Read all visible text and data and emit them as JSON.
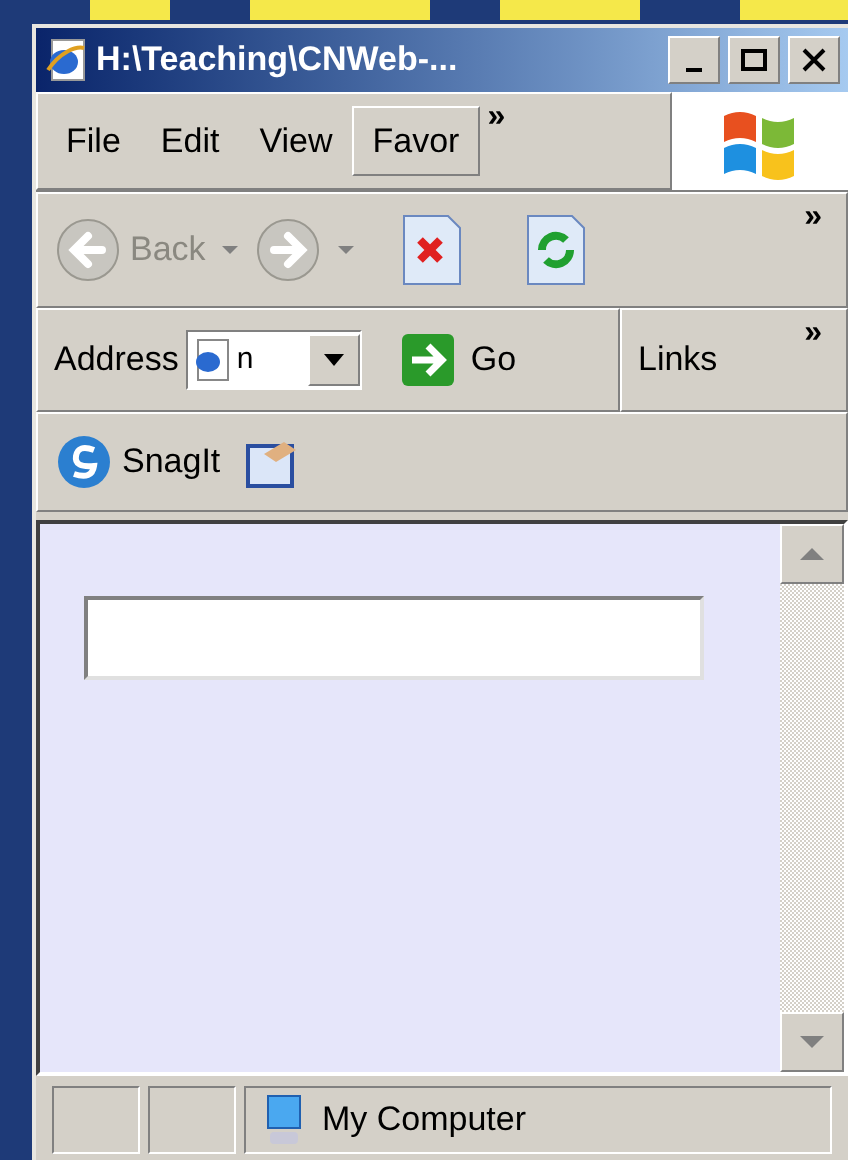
{
  "window": {
    "title": "H:\\Teaching\\CNWeb-..."
  },
  "menu": [
    {
      "label": "File",
      "selected": false
    },
    {
      "label": "Edit",
      "selected": false
    },
    {
      "label": "View",
      "selected": false
    },
    {
      "label": "Favor",
      "selected": true
    }
  ],
  "menu_overflow": "»",
  "toolbar": {
    "back": {
      "label": "Back",
      "disabled": true
    },
    "forward": {
      "disabled": true
    },
    "overflow": "»"
  },
  "address_bar": {
    "label": "Address",
    "value": "n",
    "go": "Go",
    "links": "Links",
    "overflow": "»"
  },
  "snagit_bar": {
    "label": "SnagIt"
  },
  "status_bar": {
    "zone": "My Computer"
  }
}
